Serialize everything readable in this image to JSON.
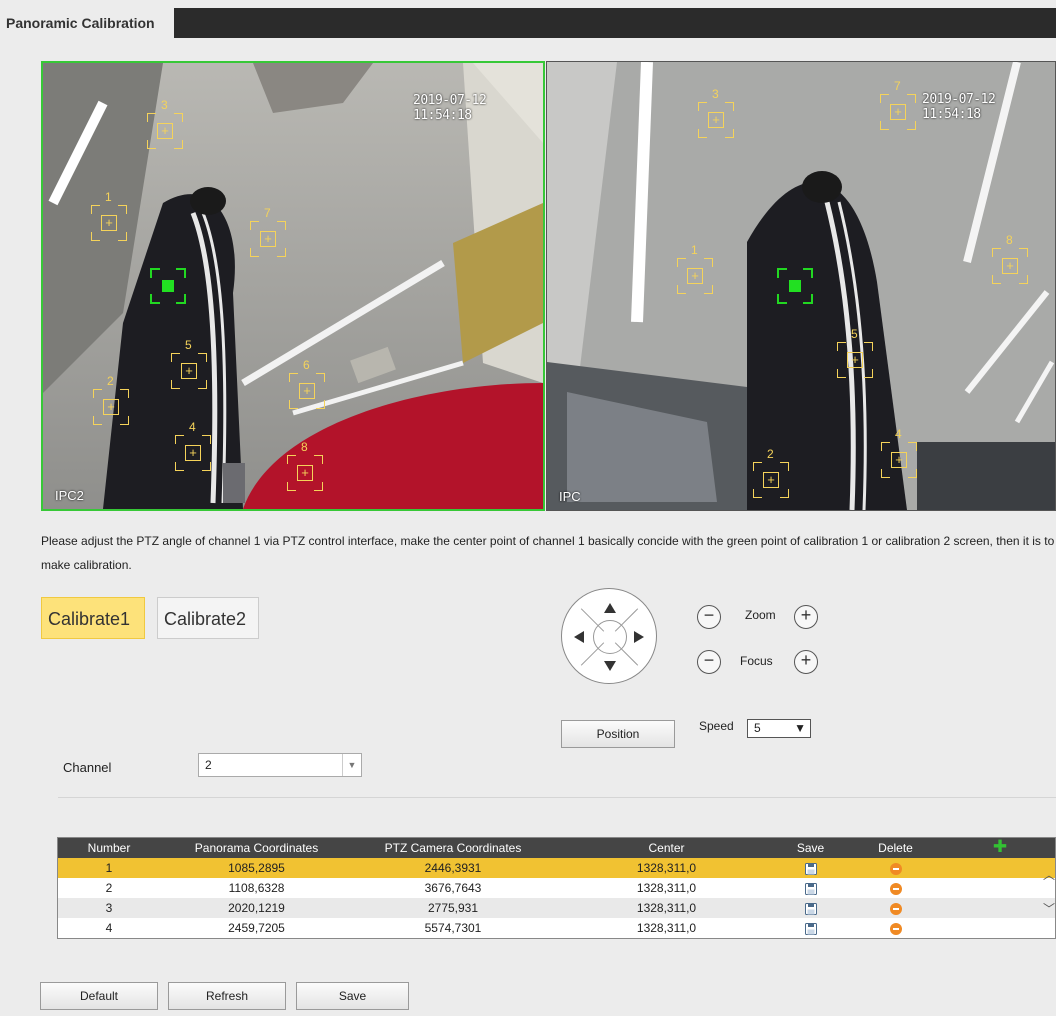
{
  "header": {
    "title": "Panoramic Calibration"
  },
  "left_video": {
    "timestamp": "2019-07-12 11:54:18",
    "name": "IPC2"
  },
  "right_video": {
    "timestamp": "2019-07-12 11:54:18",
    "name": "IPC"
  },
  "instructions": "Please adjust the PTZ angle of channel 1 via PTZ control interface, make the center point of channel 1 basically concide with the green point of calibration 1 or calibration 2 screen, then it is to make calibration.",
  "calibrate_tabs": [
    {
      "label": "Calibrate1",
      "active": true
    },
    {
      "label": "Calibrate2",
      "active": false
    }
  ],
  "ptz": {
    "zoom_label": "Zoom",
    "focus_label": "Focus",
    "minus": "−",
    "plus": "+",
    "position_label": "Position",
    "speed_label": "Speed",
    "speed_value": "5",
    "chevron": "▼"
  },
  "channel": {
    "label": "Channel",
    "value": "2"
  },
  "table": {
    "headers": [
      "Number",
      "Panorama Coordinates",
      "PTZ Camera Coordinates",
      "Center",
      "Save",
      "Delete"
    ],
    "add_icon": "plus-icon",
    "rows": [
      {
        "number": "1",
        "panorama": "1085,2895",
        "ptz": "2446,3931",
        "center": "1328,311,0"
      },
      {
        "number": "2",
        "panorama": "1108,6328",
        "ptz": "3676,7643",
        "center": "1328,311,0"
      },
      {
        "number": "3",
        "panorama": "2020,1219",
        "ptz": "2775,931",
        "center": "1328,311,0"
      },
      {
        "number": "4",
        "panorama": "2459,7205",
        "ptz": "5574,7301",
        "center": "1328,311,0"
      }
    ]
  },
  "buttons": {
    "default": "Default",
    "refresh": "Refresh",
    "save": "Save"
  },
  "colors": {
    "accent_yellow": "#f1c232",
    "calibration_green": "#22e022",
    "header_dark": "#454545",
    "delete_orange": "#f08a24"
  }
}
